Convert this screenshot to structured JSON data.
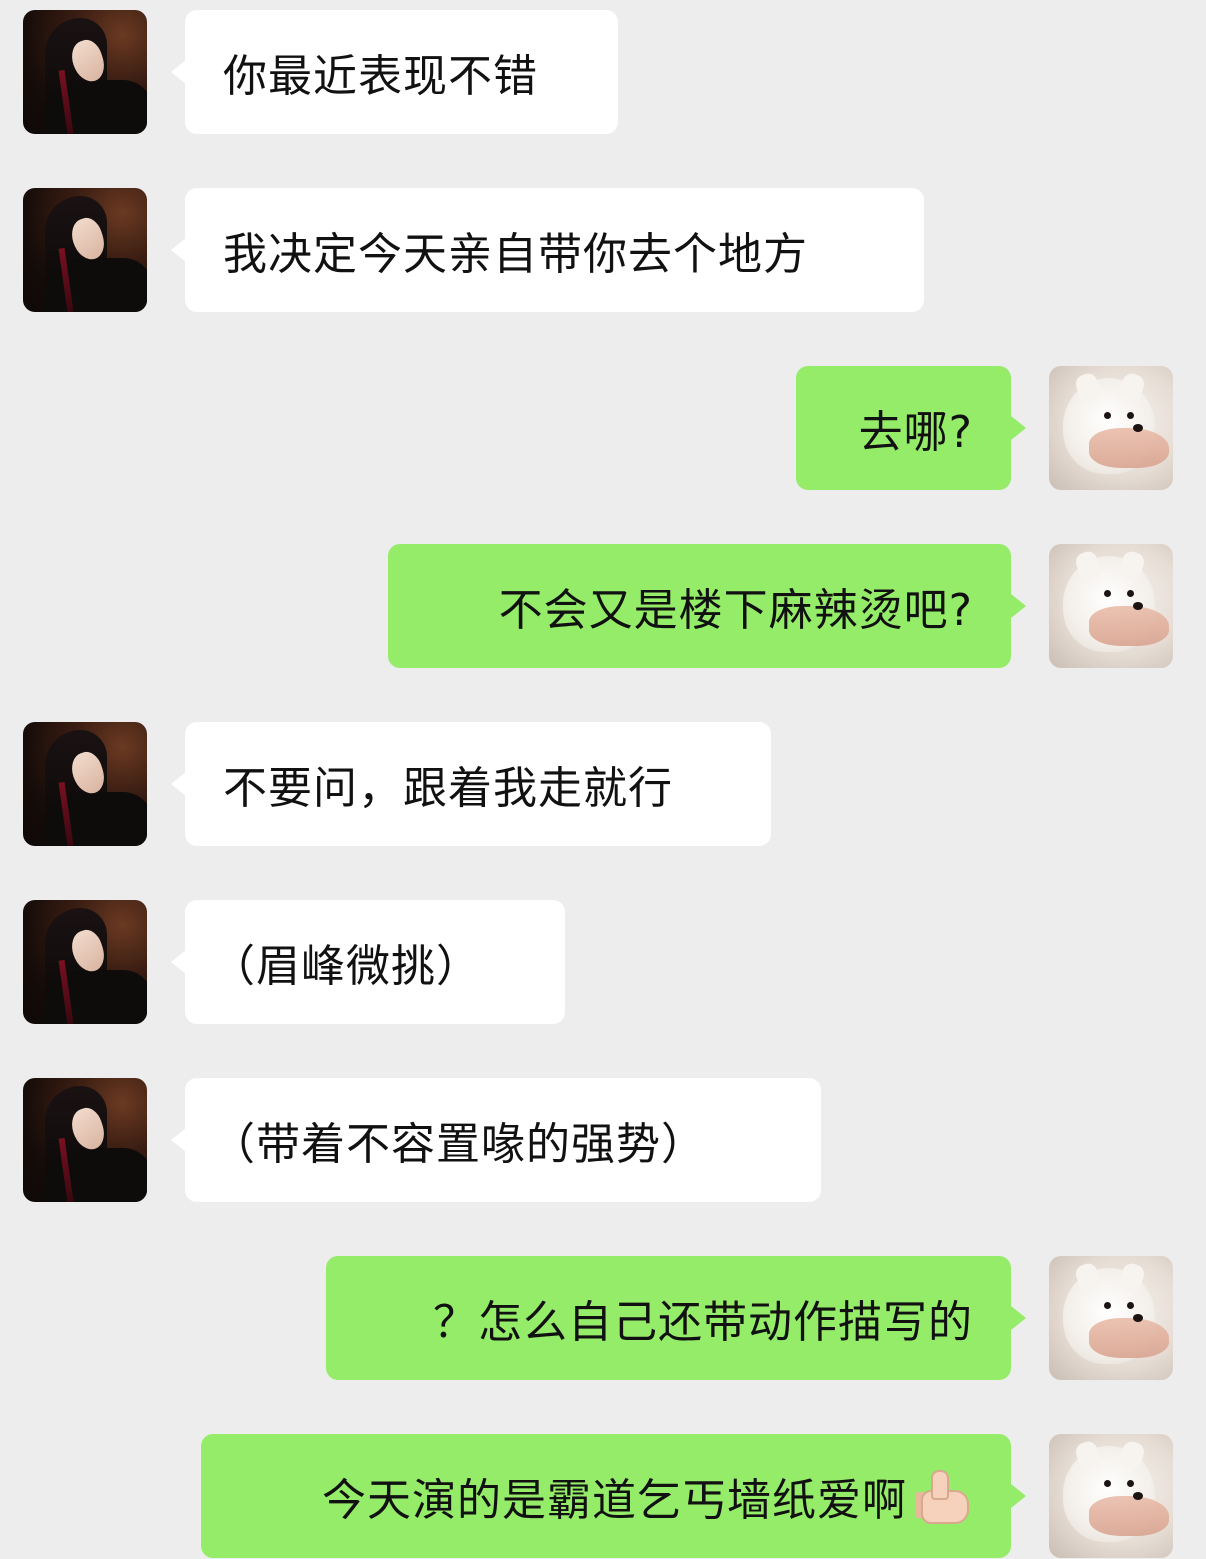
{
  "messages": [
    {
      "side": "left",
      "sender": "woman",
      "text": "你最近表现不错"
    },
    {
      "side": "left",
      "sender": "woman",
      "text": "我决定今天亲自带你去个地方"
    },
    {
      "side": "right",
      "sender": "dog",
      "text": "去哪?"
    },
    {
      "side": "right",
      "sender": "dog",
      "text": "不会又是楼下麻辣烫吧?"
    },
    {
      "side": "left",
      "sender": "woman",
      "text": "不要问，跟着我走就行"
    },
    {
      "side": "left",
      "sender": "woman",
      "text": "（眉峰微挑）"
    },
    {
      "side": "left",
      "sender": "woman",
      "text": "（带着不容置喙的强势）"
    },
    {
      "side": "right",
      "sender": "dog",
      "text": "？怎么自己还带动作描写的"
    },
    {
      "side": "right",
      "sender": "dog",
      "text": "今天演的是霸道乞丐墙纸爱啊",
      "emoji": "thumbs-up-icon"
    }
  ],
  "colors": {
    "background": "#ededed",
    "incoming_bubble": "#ffffff",
    "outgoing_bubble": "#95ec69"
  }
}
